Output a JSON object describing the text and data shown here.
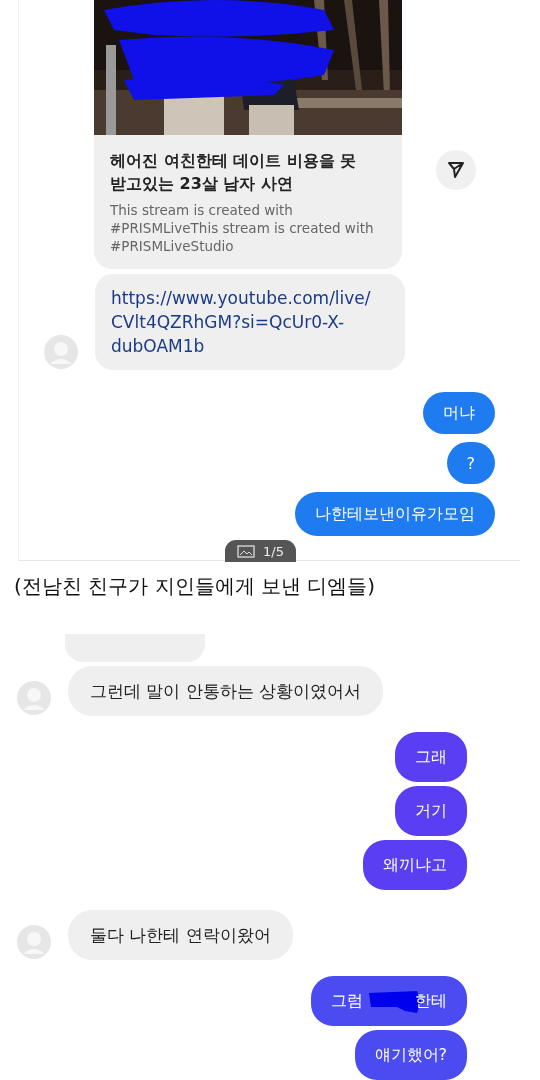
{
  "top_panel": {
    "link_preview": {
      "kind": "picture",
      "title": "헤어진 여친한테 데이트 비용을 못 받고있는 23살 남자 사연",
      "description": "This stream is created with #PRISMLiveThis stream is created with #PRISMLiveStudio"
    },
    "link_message": "https://www.youtube.com/live/CVlt4QZRhGM?si=QcUr0-X-dubOAM1b",
    "messages": [
      {
        "text": "머냐",
        "color": "#1f7cf0"
      },
      {
        "text": "?",
        "color": "#1f7cf0"
      },
      {
        "text": "나한테보낸이유가모임",
        "color": "#1f7cf0"
      }
    ],
    "page_badge": "1/5"
  },
  "caption": "(전남친 친구가 지인들에게 보낸 디엠들)",
  "bottom_panel": {
    "messages": [
      {
        "kind": "received_cut"
      },
      {
        "kind": "received",
        "text": "그런데 말이 안통하는 상황이였어서"
      },
      {
        "kind": "sent",
        "text": "그래",
        "color": "#5a3ff2"
      },
      {
        "kind": "sent",
        "text": "거기",
        "color": "#5a3ff2"
      },
      {
        "kind": "sent",
        "text": "왜끼냐고",
        "color": "#5a3ff2"
      },
      {
        "kind": "received",
        "text": "둘다 나한테 연락이왔어"
      },
      {
        "kind": "sent_redacted",
        "text_before": "그럼",
        "text_after": "한테",
        "color": "#4a4cf2"
      },
      {
        "kind": "sent",
        "text": "얘기했어?",
        "color": "#4a4cf2"
      }
    ]
  }
}
